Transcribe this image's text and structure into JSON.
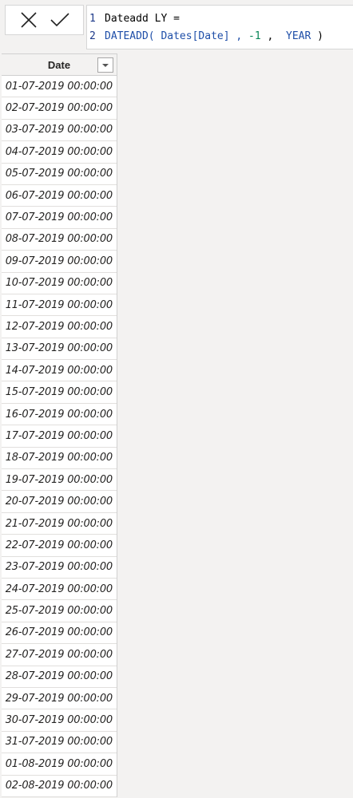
{
  "formula_bar": {
    "cancel_icon": "close-icon",
    "commit_icon": "check-icon",
    "lines": [
      {
        "number": "1",
        "tokens": [
          {
            "text": "Dateadd LY =",
            "kind": "plain"
          }
        ]
      },
      {
        "number": "2",
        "tokens": [
          {
            "text": "DATEADD(",
            "kind": "fn"
          },
          {
            "text": " Dates[Date] , ",
            "kind": "fn"
          },
          {
            "text": "-1",
            "kind": "num"
          },
          {
            "text": " ,  ",
            "kind": "plain"
          },
          {
            "text": "YEAR",
            "kind": "kw"
          },
          {
            "text": " )",
            "kind": "plain"
          }
        ]
      }
    ]
  },
  "table": {
    "column_header": "Date",
    "filter_icon": "dropdown-arrow-icon",
    "rows": [
      "01-07-2019 00:00:00",
      "02-07-2019 00:00:00",
      "03-07-2019 00:00:00",
      "04-07-2019 00:00:00",
      "05-07-2019 00:00:00",
      "06-07-2019 00:00:00",
      "07-07-2019 00:00:00",
      "08-07-2019 00:00:00",
      "09-07-2019 00:00:00",
      "10-07-2019 00:00:00",
      "11-07-2019 00:00:00",
      "12-07-2019 00:00:00",
      "13-07-2019 00:00:00",
      "14-07-2019 00:00:00",
      "15-07-2019 00:00:00",
      "16-07-2019 00:00:00",
      "17-07-2019 00:00:00",
      "18-07-2019 00:00:00",
      "19-07-2019 00:00:00",
      "20-07-2019 00:00:00",
      "21-07-2019 00:00:00",
      "22-07-2019 00:00:00",
      "23-07-2019 00:00:00",
      "24-07-2019 00:00:00",
      "25-07-2019 00:00:00",
      "26-07-2019 00:00:00",
      "27-07-2019 00:00:00",
      "28-07-2019 00:00:00",
      "29-07-2019 00:00:00",
      "30-07-2019 00:00:00",
      "31-07-2019 00:00:00",
      "01-08-2019 00:00:00",
      "02-08-2019 00:00:00"
    ]
  }
}
